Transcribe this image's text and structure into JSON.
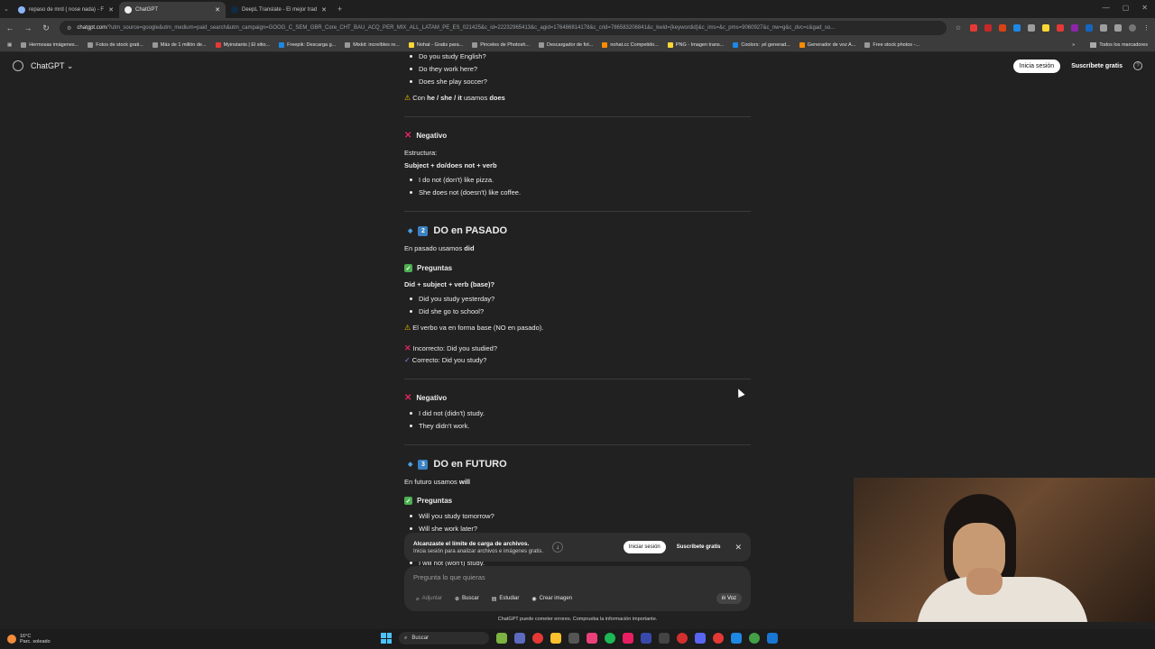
{
  "browser": {
    "tabs": [
      {
        "label": "repaso de mrd ( nose nada) - F"
      },
      {
        "label": "ChatGPT"
      },
      {
        "label": "DeepL Translate - El mejor trad"
      }
    ],
    "url_host": "chatgpt.com",
    "url_rest": "/?utm_source=google&utm_medium=paid_search&utm_campaign=GOOG_C_SEM_GBR_Core_CHT_BAU_ACQ_PER_MIX_ALL_LATAM_PE_ES_021425&c_id=22232965413&c_agid=176486814178&c_crid=786583206841&c_kwid={keywordid}&c_ims=&c_pms=9060927&c_nw=g&c_dvc=c&gad_so...",
    "bookmarks": [
      "Hermosas imágenes...",
      "Fotos de stock grati...",
      "Más de 1 millón de...",
      "Myinstants | El sitio...",
      "Freepik: Descarga g...",
      "Mixkit: increíbles re...",
      "Nohat - Gratis para...",
      "Pinceles de Photosh...",
      "Descargador de fot...",
      "nohat.cc Competido...",
      "PNG - Imagen trans...",
      "Coolors: ¡el generad...",
      "Generador de voz A...",
      "Free stock photos -..."
    ],
    "bookmarks_all": "Todos los marcadores"
  },
  "header": {
    "title": "ChatGPT",
    "login": "Inicia sesión",
    "signup": "Suscríbete gratis"
  },
  "content": {
    "q1": "Do you study English?",
    "q2": "Do they work here?",
    "q3": "Does she play soccer?",
    "note_con": "Con ",
    "note_pron": "he / she / it",
    "note_usamos": " usamos ",
    "note_does": "does",
    "neg_title": "Negativo",
    "estructura": "Estructura:",
    "neg_struct": "Subject + do/does not + verb",
    "neg1": "I do not (don't) like pizza.",
    "neg2": "She does not (doesn't) like coffee.",
    "past_num": "2",
    "past_title": "DO en PASADO",
    "past_intro_a": "En pasado usamos ",
    "past_intro_b": "did",
    "preg_title": "Preguntas",
    "past_struct": "Did + subject + verb (base)?",
    "pq1": "Did you study yesterday?",
    "pq2": "Did she go to school?",
    "past_warn": "El verbo va en forma base (NO en pasado).",
    "incorrect": "Incorrecto: Did you studied?",
    "correct": "Correcto: Did you study?",
    "pneg1": "I did not (didn't) study.",
    "pneg2": "They didn't work.",
    "fut_num": "3",
    "fut_title": "DO en FUTURO",
    "fut_intro_a": "En futuro usamos ",
    "fut_intro_b": "will",
    "fq1": "Will you study tomorrow?",
    "fq2": "Will she work later?",
    "fneg1": "I will not (won't) study."
  },
  "notice": {
    "title": "Alcanzaste el límite de carga de archivos.",
    "body": "Inicia sesión para analizar archivos e imágenes gratis.",
    "login": "Iniciar sesión",
    "signup": "Suscríbete gratis"
  },
  "composer": {
    "placeholder": "Pregunta lo que quieras",
    "attach": "Adjuntar",
    "search": "Buscar",
    "study": "Estudiar",
    "image": "Crear imagen",
    "voice": "Voz"
  },
  "disclaimer": "ChatGPT puede cometer errores. Comprueba la información importante.",
  "taskbar": {
    "temp": "16°C",
    "weather": "Parc. soleado",
    "search": "Buscar"
  }
}
